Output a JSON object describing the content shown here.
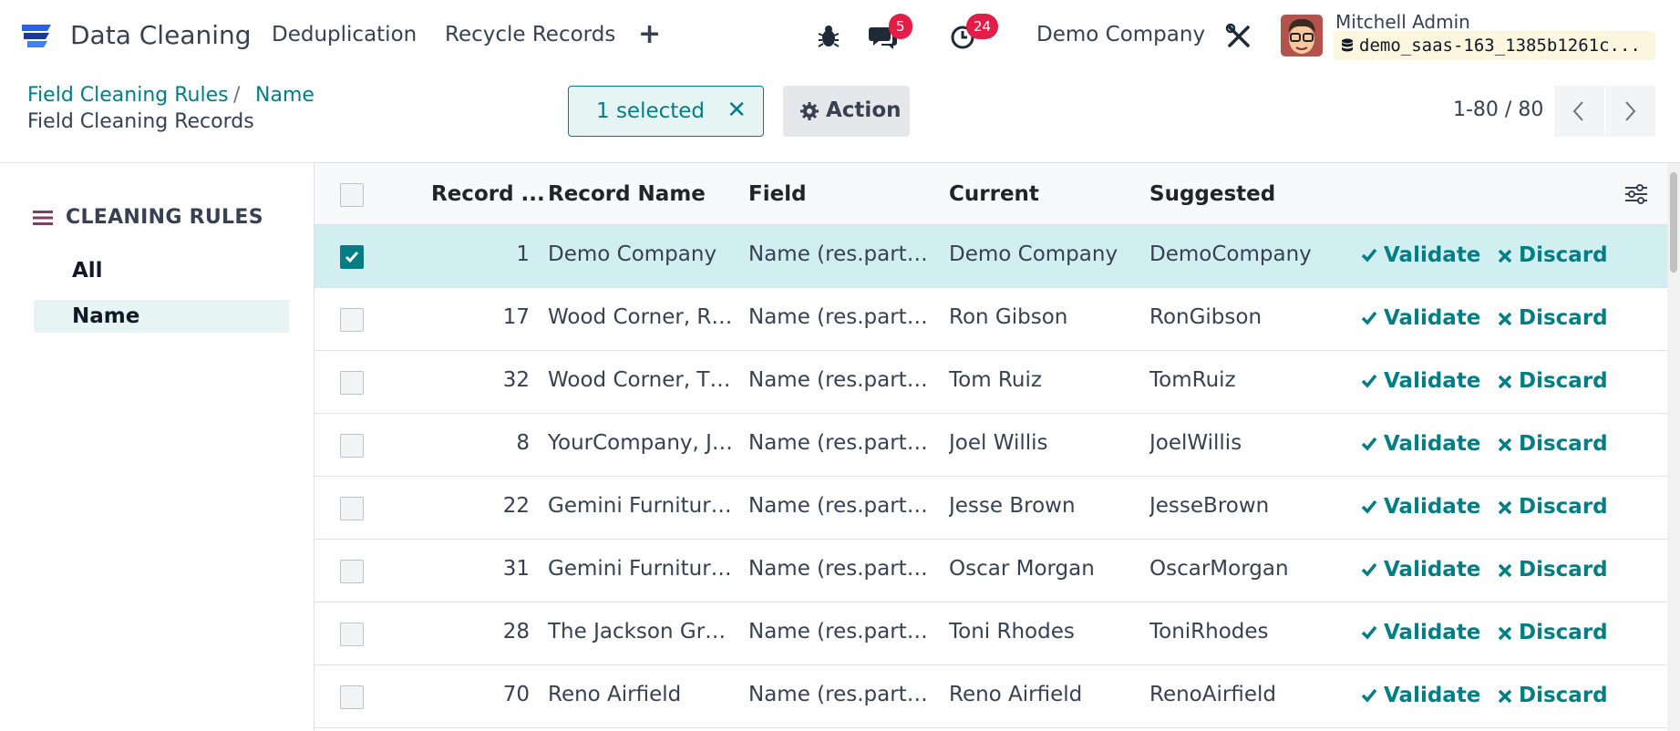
{
  "navbar": {
    "app_name": "Data Cleaning",
    "menu": [
      "Deduplication",
      "Recycle Records"
    ],
    "messages_count": "5",
    "activities_count": "24",
    "company": "Demo Company",
    "user_name": "Mitchell Admin",
    "database": "demo_saas-163_1385b1261c..."
  },
  "breadcrumb": {
    "parent": "Field Cleaning Rules",
    "separator": "/",
    "current": "Name",
    "subtitle": "Field Cleaning Records"
  },
  "selection": {
    "label": "1 selected"
  },
  "action": {
    "label": "Action"
  },
  "pager": {
    "value": "1-80 / 80"
  },
  "sidebar": {
    "title": "CLEANING RULES",
    "items": [
      "All",
      "Name"
    ],
    "active": "Name"
  },
  "list": {
    "columns": {
      "record_id": "Record ...",
      "record_name": "Record Name",
      "field": "Field",
      "current": "Current",
      "suggested": "Suggested"
    },
    "validate_label": "Validate",
    "discard_label": "Discard",
    "rows": [
      {
        "id": "1",
        "name": "Demo Company",
        "field": "Name (res.part…",
        "current": "Demo Company",
        "suggested": "DemoCompany",
        "selected": true
      },
      {
        "id": "17",
        "name": "Wood Corner, R…",
        "field": "Name (res.part…",
        "current": "Ron Gibson",
        "suggested": "RonGibson",
        "selected": false
      },
      {
        "id": "32",
        "name": "Wood Corner, T…",
        "field": "Name (res.part…",
        "current": "Tom Ruiz",
        "suggested": "TomRuiz",
        "selected": false
      },
      {
        "id": "8",
        "name": "YourCompany, J…",
        "field": "Name (res.part…",
        "current": "Joel Willis",
        "suggested": "JoelWillis",
        "selected": false
      },
      {
        "id": "22",
        "name": "Gemini Furnitur…",
        "field": "Name (res.part…",
        "current": "Jesse Brown",
        "suggested": "JesseBrown",
        "selected": false
      },
      {
        "id": "31",
        "name": "Gemini Furnitur…",
        "field": "Name (res.part…",
        "current": "Oscar Morgan",
        "suggested": "OscarMorgan",
        "selected": false
      },
      {
        "id": "28",
        "name": "The Jackson Gr…",
        "field": "Name (res.part…",
        "current": "Toni Rhodes",
        "suggested": "ToniRhodes",
        "selected": false
      },
      {
        "id": "70",
        "name": "Reno Airfield",
        "field": "Name (res.part…",
        "current": "Reno Airfield",
        "suggested": "RenoAirfield",
        "selected": false
      }
    ]
  },
  "colors": {
    "accent": "#017e84",
    "badge": "#e11d48",
    "selected_row": "#d1eef0"
  }
}
